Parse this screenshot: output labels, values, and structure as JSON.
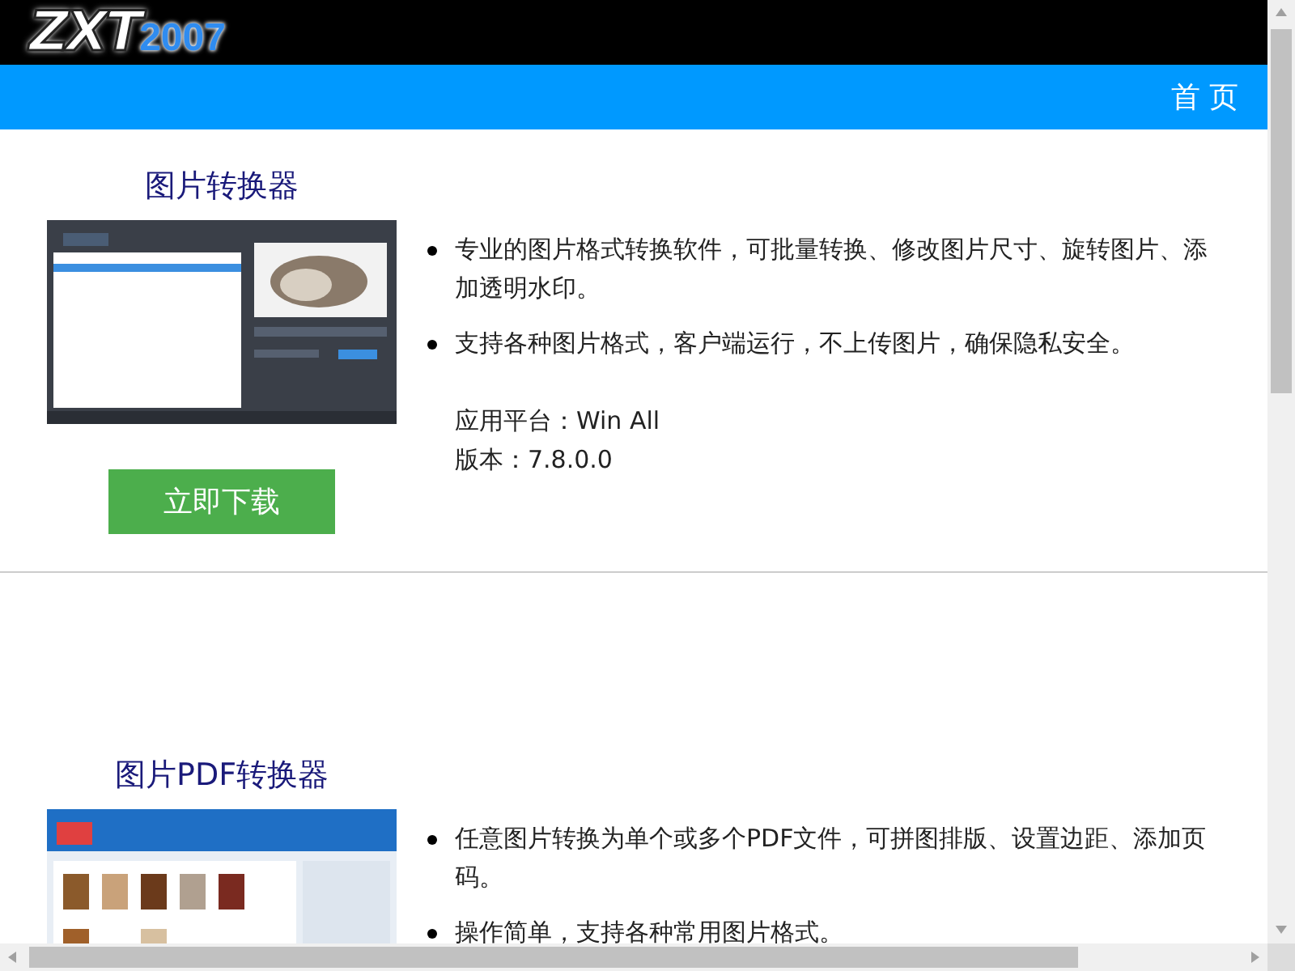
{
  "logo": {
    "main": "ZXT",
    "sub": "2007"
  },
  "nav": [
    {
      "label": "首 页"
    }
  ],
  "products": [
    {
      "title": "图片转换器",
      "bullets": [
        "专业的图片格式转换软件，可批量转换、修改图片尺寸、旋转图片、添加透明水印。",
        "支持各种图片格式，客户端运行，不上传图片，确保隐私安全。"
      ],
      "platform": "应用平台：Win All",
      "version": "版本：7.8.0.0",
      "download": "立即下载"
    },
    {
      "title": "图片PDF转换器",
      "bullets": [
        "任意图片转换为单个或多个PDF文件，可拼图排版、设置边距、添加页码。",
        "操作简单，支持各种常用图片格式。"
      ]
    }
  ]
}
